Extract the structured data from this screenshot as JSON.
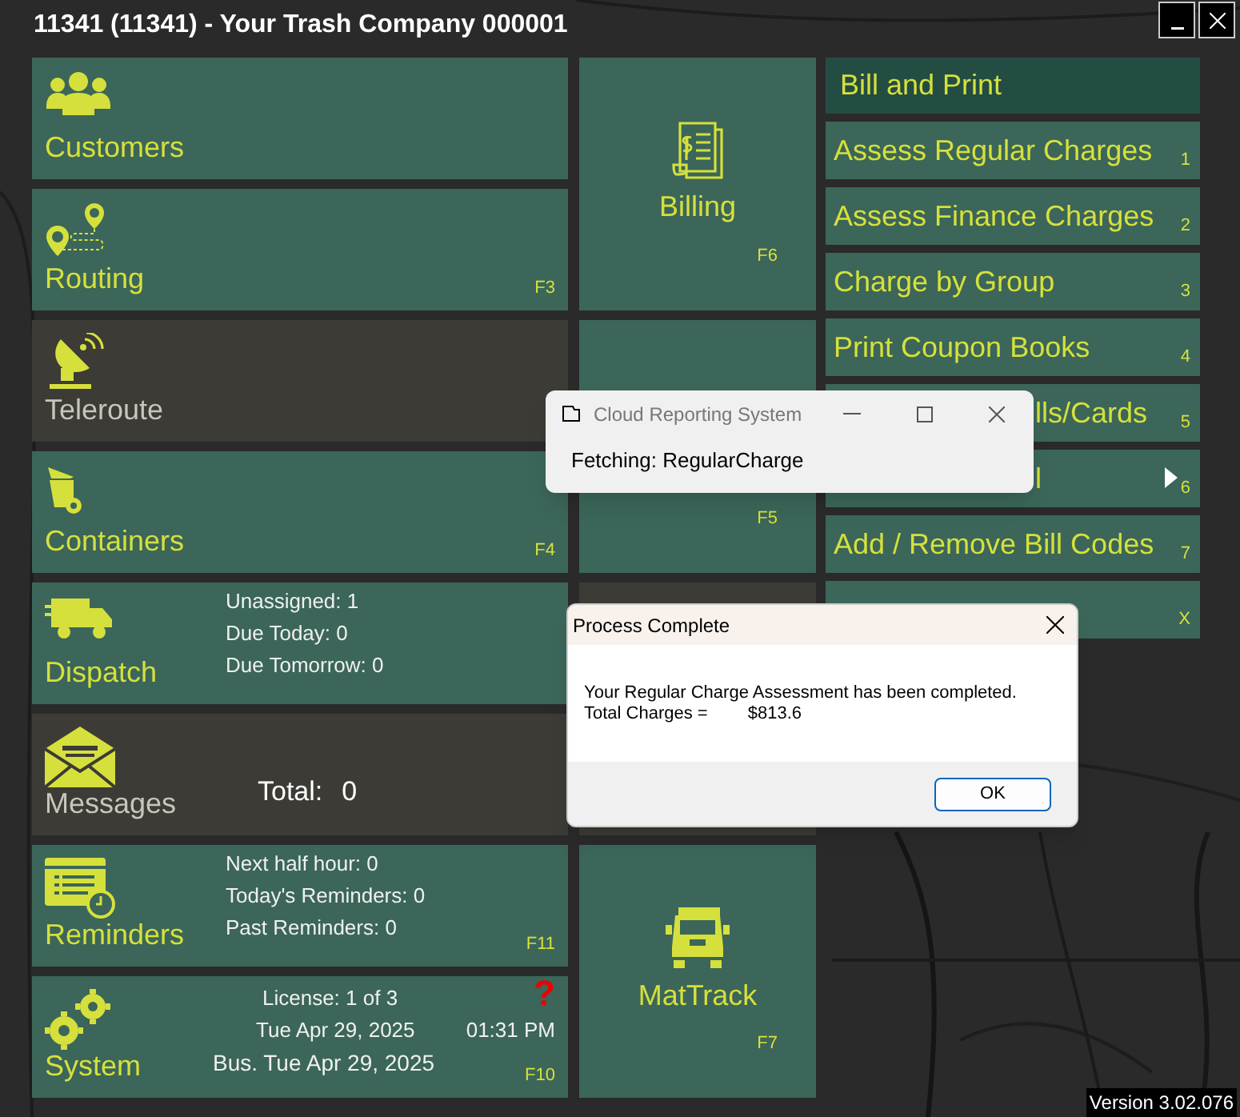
{
  "window": {
    "title": "11341 (11341) - Your Trash Company 000001"
  },
  "left_tiles": [
    {
      "kind": "customers",
      "label": "Customers",
      "disabled": false
    },
    {
      "kind": "routing",
      "label": "Routing",
      "key": "F3",
      "disabled": false
    },
    {
      "kind": "teleroute",
      "label": "Teleroute",
      "disabled": true
    },
    {
      "kind": "containers",
      "label": "Containers",
      "key": "F4",
      "disabled": false
    },
    {
      "kind": "dispatch",
      "label": "Dispatch",
      "disabled": false,
      "lines": [
        "Unassigned: 1",
        "Due Today: 0",
        "Due Tomorrow: 0"
      ]
    },
    {
      "kind": "messages",
      "label": "Messages",
      "disabled": true,
      "total_label": "Total:",
      "total_value": "0"
    },
    {
      "kind": "reminders",
      "label": "Reminders",
      "key": "F11",
      "disabled": false,
      "lines": [
        "Next half hour: 0",
        "Today's Reminders: 0",
        "Past Reminders: 0"
      ]
    },
    {
      "kind": "system",
      "label": "System",
      "key": "F10",
      "disabled": false,
      "license": "License: 1 of 3",
      "date": "Tue Apr 29, 2025",
      "time": "01:31 PM",
      "help": "?",
      "business_date": "Bus. Tue Apr 29, 2025"
    }
  ],
  "middle_tiles": [
    {
      "kind": "billing",
      "label": "Billing",
      "key": "F6",
      "disabled": false
    },
    {
      "kind": "reports",
      "key": "F5",
      "disabled": false
    },
    {
      "kind": "blank",
      "disabled": true
    },
    {
      "kind": "mattrack",
      "label": "MatTrack",
      "key": "F7",
      "disabled": false
    }
  ],
  "billing_menu": {
    "title": "Bill and Print",
    "items": [
      {
        "label": "Assess Regular Charges",
        "key": "1",
        "covered": false,
        "submenu": false
      },
      {
        "label": "Assess Finance Charges",
        "key": "2",
        "covered": false,
        "submenu": false
      },
      {
        "label": "Charge by Group",
        "key": "3",
        "covered": false,
        "submenu": false
      },
      {
        "label": "Print Coupon Books",
        "key": "4",
        "covered": false,
        "submenu": false
      },
      {
        "label": "lls/Cards",
        "key": "5",
        "covered": true,
        "submenu": false
      },
      {
        "label": "l",
        "key": "6",
        "covered": true,
        "submenu": true
      },
      {
        "label": "Add / Remove Bill Codes",
        "key": "7",
        "covered": false,
        "submenu": false
      },
      {
        "key": "X",
        "covered": true,
        "submenu": false
      }
    ]
  },
  "cloud_dialog": {
    "title": "Cloud Reporting System",
    "message": "Fetching: RegularCharge"
  },
  "process_dialog": {
    "title": "Process Complete",
    "message": "Your Regular Charge Assessment has been completed.",
    "total_label": "Total Charges =",
    "total_value": "$813.6",
    "button": "OK"
  },
  "version": "Version 3.02.076"
}
